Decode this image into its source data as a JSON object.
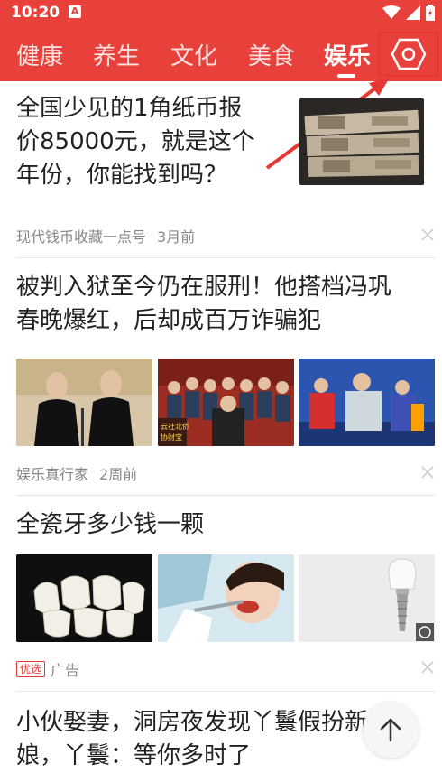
{
  "status": {
    "time": "10:20",
    "notif_letter": "A"
  },
  "tabs": [
    "健康",
    "养生",
    "文化",
    "美食",
    "娱乐"
  ],
  "active_tab": "娱乐",
  "feed": [
    {
      "title_lines": [
        "全国少见的1角纸币报",
        "价85000元，就是这个",
        "年份，你能找到吗？"
      ],
      "source": "现代钱币收藏一点号",
      "time": "3月前"
    },
    {
      "title_lines": [
        "被判入狱至今仍在服刑！他搭档冯巩",
        "春晚爆红，后却成百万诈骗犯"
      ],
      "source": "娱乐真行家",
      "time": "2周前",
      "img2_caption_lines": [
        "云社北侨",
        "协财宝"
      ]
    },
    {
      "title_lines": [
        "全瓷牙多少钱一颗"
      ],
      "badge": "优选",
      "source": "广告"
    },
    {
      "title_lines": [
        "小伙娶妻，洞房夜发现丫鬟假扮新",
        "娘，丫鬟：等你多时了"
      ]
    }
  ],
  "icons": {
    "settings": "hexagon-settings-icon",
    "back_to_top": "arrow-up-icon",
    "close": "close-icon"
  },
  "colors": {
    "brand": "#e8403a",
    "highlight_box": "#e53935",
    "annotation_arrow": "#e53935"
  }
}
